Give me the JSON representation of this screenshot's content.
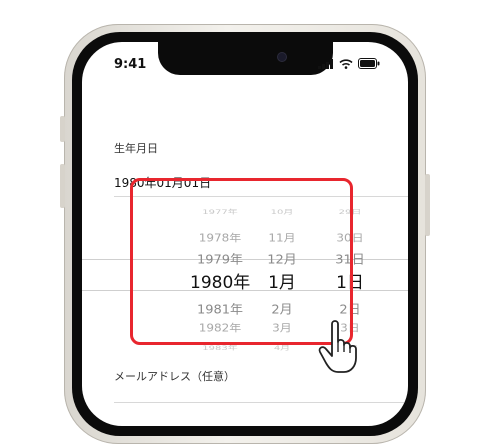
{
  "status_bar": {
    "time": "9:41"
  },
  "form": {
    "birth_label": "生年月日",
    "birth_value": "1980年01月01日",
    "email_label": "メールアドレス（任意）"
  },
  "picker": {
    "rows": [
      {
        "year": "1977年",
        "month": "10月",
        "day": "29日"
      },
      {
        "year": "1978年",
        "month": "11月",
        "day": "30日"
      },
      {
        "year": "1979年",
        "month": "12月",
        "day": "31日"
      },
      {
        "year": "1980年",
        "month": "1月",
        "day": "1日"
      },
      {
        "year": "1981年",
        "month": "2月",
        "day": "2日"
      },
      {
        "year": "1982年",
        "month": "3月",
        "day": "3日"
      },
      {
        "year": "1983年",
        "month": "4月",
        "day": "4日"
      }
    ],
    "selected_index": 3
  },
  "colors": {
    "highlight": "#e8262e",
    "frame": "#e9e6df"
  },
  "icons": [
    "signal-icon",
    "wifi-icon",
    "battery-icon",
    "hand-pointer-icon"
  ]
}
